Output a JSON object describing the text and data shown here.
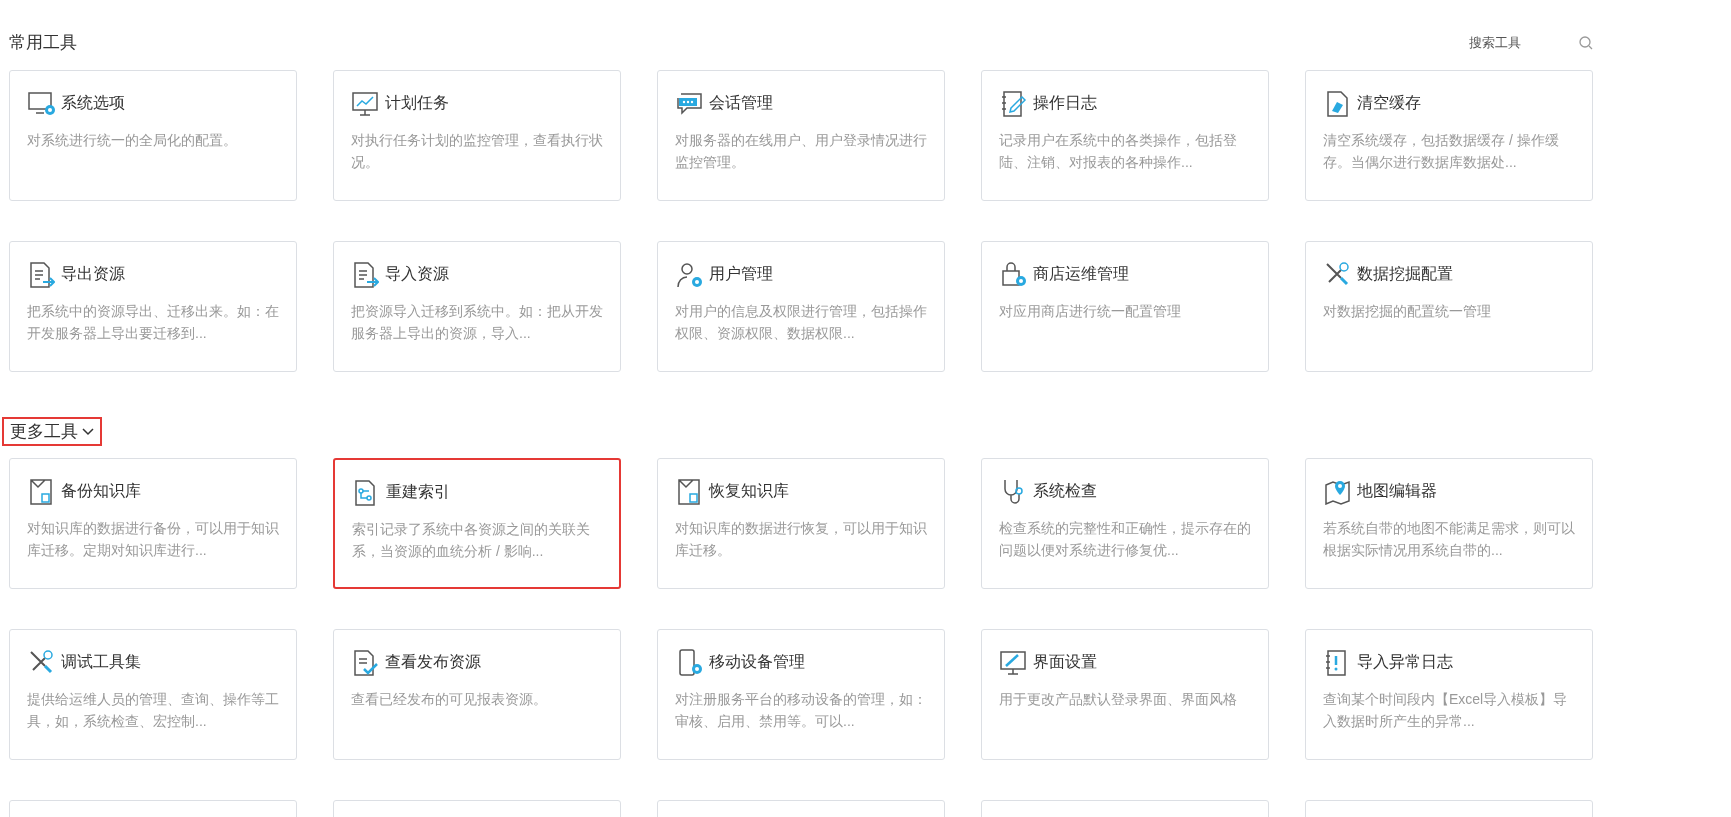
{
  "common_tools": {
    "title": "常用工具",
    "search": {
      "placeholder": "搜索工具"
    },
    "rows": [
      {
        "cards": [
          {
            "kind": "tool",
            "title": "系统选项",
            "description": "对系统进行统一的全局化的配置。",
            "highlighted": false
          },
          {
            "kind": "tool",
            "title": "计划任务",
            "description": "对执行任务计划的监控管理，查看执行状况。",
            "highlighted": false
          },
          {
            "kind": "tool",
            "title": "会话管理",
            "description": "对服务器的在线用户、用户登录情况进行监控管理。",
            "highlighted": false
          },
          {
            "kind": "tool",
            "title": "操作日志",
            "description": "记录用户在系统中的各类操作，包括登陆、注销、对报表的各种操作...",
            "highlighted": false
          },
          {
            "kind": "tool",
            "title": "清空缓存",
            "description": "清空系统缓存，包括数据缓存 / 操作缓存。当偶尔进行数据库数据处...",
            "highlighted": false
          }
        ]
      },
      {
        "cards": [
          {
            "kind": "tool",
            "title": "导出资源",
            "description": "把系统中的资源导出、迁移出来。如：在开发服务器上导出要迁移到...",
            "highlighted": false
          },
          {
            "kind": "tool",
            "title": "导入资源",
            "description": "把资源导入迁移到系统中。如：把从开发服务器上导出的资源，导入...",
            "highlighted": false
          },
          {
            "kind": "tool",
            "title": "用户管理",
            "description": "对用户的信息及权限进行管理，包括操作权限、资源权限、数据权限...",
            "highlighted": false
          },
          {
            "kind": "tool",
            "title": "商店运维管理",
            "description": "对应用商店进行统一配置管理",
            "highlighted": false
          },
          {
            "kind": "tool",
            "title": "数据挖掘配置",
            "description": "对数据挖掘的配置统一管理",
            "highlighted": false
          }
        ]
      }
    ]
  },
  "more_tools": {
    "title": "更多工具",
    "highlighted": true,
    "rows": [
      {
        "cards": [
          {
            "kind": "tool",
            "title": "备份知识库",
            "description": "对知识库的数据进行备份，可以用于知识库迁移。定期对知识库进行...",
            "highlighted": false
          },
          {
            "kind": "tool",
            "title": "重建索引",
            "description": "索引记录了系统中各资源之间的关联关系，当资源的血统分析 / 影响...",
            "highlighted": true
          },
          {
            "kind": "tool",
            "title": "恢复知识库",
            "description": "对知识库的数据进行恢复，可以用于知识库迁移。",
            "highlighted": false
          },
          {
            "kind": "tool",
            "title": "系统检查",
            "description": "检查系统的完整性和正确性，提示存在的问题以便对系统进行修复优...",
            "highlighted": false
          },
          {
            "kind": "tool",
            "title": "地图编辑器",
            "description": "若系统自带的地图不能满足需求，则可以根据实际情况用系统自带的...",
            "highlighted": false
          }
        ]
      },
      {
        "cards": [
          {
            "kind": "tool",
            "title": "调试工具集",
            "description": "提供给运维人员的管理、查询、操作等工具，如，系统检查、宏控制...",
            "highlighted": false
          },
          {
            "kind": "tool",
            "title": "查看发布资源",
            "description": "查看已经发布的可见报表资源。",
            "highlighted": false
          },
          {
            "kind": "tool",
            "title": "移动设备管理",
            "description": "对注册服务平台的移动设备的管理，如：审核、启用、禁用等。可以...",
            "highlighted": false
          },
          {
            "kind": "tool",
            "title": "界面设置",
            "description": "用于更改产品默认登录界面、界面风格",
            "highlighted": false
          },
          {
            "kind": "tool",
            "title": "导入异常日志",
            "description": "查询某个时间段内【Excel导入模板】导入数据时所产生的异常...",
            "highlighted": false
          }
        ]
      },
      {
        "cards": [
          {
            "kind": "cut-off"
          },
          {
            "kind": "cut-off"
          },
          {
            "kind": "cut-off"
          },
          {
            "kind": "cut-off"
          },
          {
            "kind": "cut-off"
          }
        ]
      }
    ]
  }
}
